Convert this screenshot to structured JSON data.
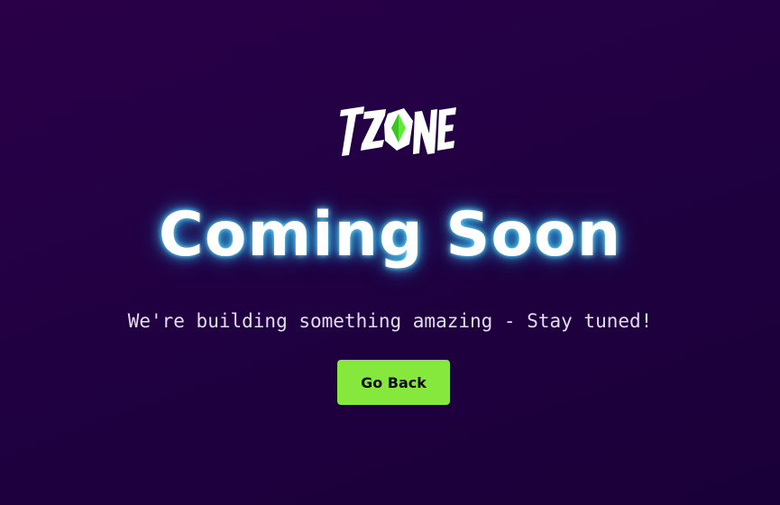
{
  "brand": {
    "logo_text": "TZONE",
    "icon": "green-gem-icon",
    "accent_color": "#86e83d"
  },
  "hero": {
    "headline": "Coming Soon",
    "tagline": "We're building something amazing - Stay tuned!"
  },
  "actions": {
    "go_back_label": "Go Back"
  },
  "colors": {
    "background": "#22003f",
    "glow": "#32c8ff",
    "button_bg": "#86e83d"
  }
}
